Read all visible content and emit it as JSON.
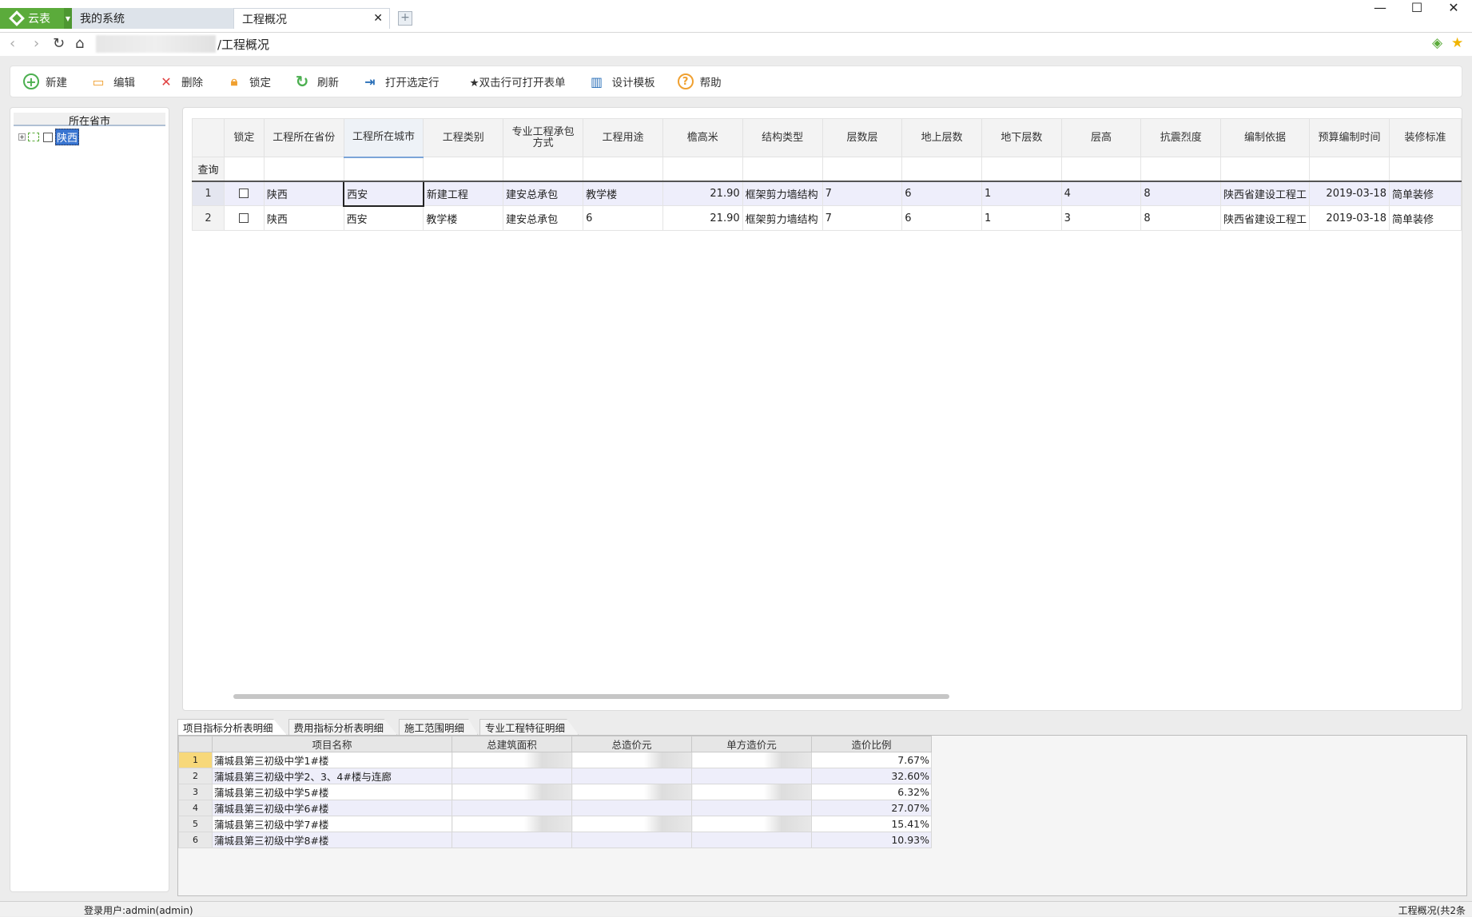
{
  "window": {
    "brand": "云表",
    "tabs": [
      {
        "label": "我的系统"
      },
      {
        "label": "工程概况"
      }
    ],
    "path": "/工程概况"
  },
  "toolbar": {
    "new": "新建",
    "edit": "编辑",
    "delete": "删除",
    "lock": "锁定",
    "refresh": "刷新",
    "open_selected": "打开选定行",
    "dblclick_hint": "★双击行可打开表单",
    "design_template": "设计模板",
    "help": "帮助"
  },
  "tree": {
    "header": "所在省市",
    "nodes": [
      {
        "label": "陕西"
      }
    ]
  },
  "grid": {
    "filter_label": "查询",
    "columns": [
      "锁定",
      "工程所在省份",
      "工程所在城市",
      "工程类别",
      "专业工程承包方式",
      "工程用途",
      "檐高米",
      "结构类型",
      "层数层",
      "地上层数",
      "地下层数",
      "层高",
      "抗震烈度",
      "编制依据",
      "预算编制时间",
      "装修标准"
    ],
    "rows": [
      {
        "n": "1",
        "province": "陕西",
        "city": "西安",
        "category": "新建工程",
        "contract": "建安总承包",
        "usage": "教学楼",
        "height": "21.90",
        "structure": "框架剪力墙结构",
        "floors": "7",
        "above": "6",
        "below": "1",
        "floor_h": "4",
        "seismic": "8",
        "basis": "陕西省建设工程工",
        "date": "2019-03-18",
        "decor": "简单装修"
      },
      {
        "n": "2",
        "province": "陕西",
        "city": "西安",
        "category": "教学楼",
        "contract": "建安总承包",
        "usage": "6",
        "height": "21.90",
        "structure": "框架剪力墙结构",
        "floors": "7",
        "above": "6",
        "below": "1",
        "floor_h": "3",
        "seismic": "8",
        "basis": "陕西省建设工程工",
        "date": "2019-03-18",
        "decor": "简单装修"
      }
    ]
  },
  "subtabs": [
    "项目指标分析表明细",
    "费用指标分析表明细",
    "施工范围明细",
    "专业工程特征明细"
  ],
  "detail": {
    "columns": [
      "项目名称",
      "总建筑面积",
      "总造价元",
      "单方造价元",
      "造价比例"
    ],
    "rows": [
      {
        "n": "1",
        "name": "蒲城县第三初级中学1#楼",
        "ratio": "7.67%"
      },
      {
        "n": "2",
        "name": "蒲城县第三初级中学2、3、4#楼与连廊",
        "ratio": "32.60%"
      },
      {
        "n": "3",
        "name": "蒲城县第三初级中学5#楼",
        "ratio": "6.32%"
      },
      {
        "n": "4",
        "name": "蒲城县第三初级中学6#楼",
        "ratio": "27.07%"
      },
      {
        "n": "5",
        "name": "蒲城县第三初级中学7#楼",
        "ratio": "15.41%"
      },
      {
        "n": "6",
        "name": "蒲城县第三初级中学8#楼",
        "ratio": "10.93%"
      }
    ]
  },
  "status": {
    "user": "登录用户:admin(admin)",
    "summary": "工程概况(共2条"
  },
  "colors": {
    "brand": "#5bab3b",
    "selection": "#3874d0",
    "row_highlight": "#eeeefb"
  }
}
